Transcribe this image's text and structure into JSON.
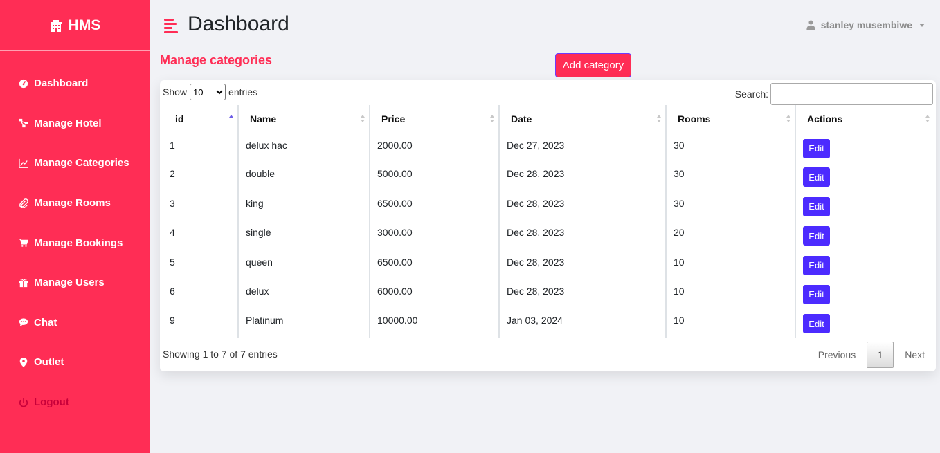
{
  "brand": {
    "name": "HMS",
    "icon": "hotel-icon"
  },
  "sidebar": {
    "items": [
      {
        "label": "Dashboard",
        "icon": "gauge-icon"
      },
      {
        "label": "Manage Hotel",
        "icon": "sitemap-icon"
      },
      {
        "label": "Manage Categories",
        "icon": "chart-line-icon"
      },
      {
        "label": "Manage Rooms",
        "icon": "paperclip-icon"
      },
      {
        "label": "Manage Bookings",
        "icon": "cart-icon"
      },
      {
        "label": "Manage Users",
        "icon": "gift-icon"
      },
      {
        "label": "Chat",
        "icon": "chat-icon"
      },
      {
        "label": "Outlet",
        "icon": "map-marker-icon"
      },
      {
        "label": "Logout",
        "icon": "power-icon"
      }
    ]
  },
  "header": {
    "title": "Dashboard",
    "user": "stanley musembiwe"
  },
  "section": {
    "title": "Manage categories",
    "add_button": "Add category"
  },
  "table_controls": {
    "show_label": "Show",
    "entries_label": "entries",
    "page_size": "10",
    "search_label": "Search:",
    "search_value": ""
  },
  "table": {
    "columns": [
      "id",
      "Name",
      "Price",
      "Date",
      "Rooms",
      "Actions"
    ],
    "rows": [
      {
        "id": "1",
        "name": "delux hac",
        "price": "2000.00",
        "date": "Dec 27, 2023",
        "rooms": "30",
        "action": "Edit"
      },
      {
        "id": "2",
        "name": "double",
        "price": "5000.00",
        "date": "Dec 28, 2023",
        "rooms": "30",
        "action": "Edit"
      },
      {
        "id": "3",
        "name": "king",
        "price": "6500.00",
        "date": "Dec 28, 2023",
        "rooms": "30",
        "action": "Edit"
      },
      {
        "id": "4",
        "name": "single",
        "price": "3000.00",
        "date": "Dec 28, 2023",
        "rooms": "20",
        "action": "Edit"
      },
      {
        "id": "5",
        "name": "queen",
        "price": "6500.00",
        "date": "Dec 28, 2023",
        "rooms": "10",
        "action": "Edit"
      },
      {
        "id": "6",
        "name": "delux",
        "price": "6000.00",
        "date": "Dec 28, 2023",
        "rooms": "10",
        "action": "Edit"
      },
      {
        "id": "9",
        "name": "Platinum",
        "price": "10000.00",
        "date": "Jan 03, 2024",
        "rooms": "10",
        "action": "Edit"
      }
    ]
  },
  "footer": {
    "info": "Showing 1 to 7 of 7 entries",
    "previous": "Previous",
    "page": "1",
    "next": "Next"
  },
  "colors": {
    "accent": "#ff2d55",
    "button": "#4c2bff"
  }
}
